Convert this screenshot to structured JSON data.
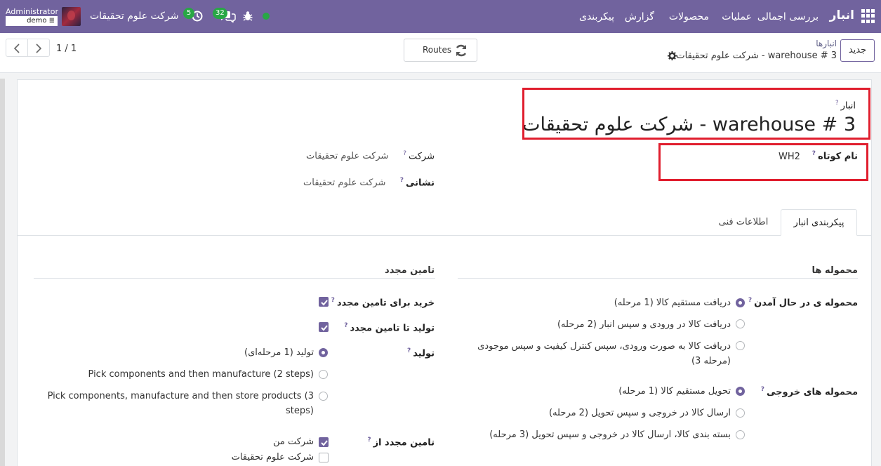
{
  "nav": {
    "brand": "انبار",
    "menu": [
      "بررسی اجمالی",
      "عملیات",
      "محصولات",
      "گزارش",
      "پیکربندی"
    ],
    "chat_count": "32",
    "activity_count": "5",
    "company": "شرکت علوم تحقیقات",
    "user_name": "Administrator",
    "user_db": "demo"
  },
  "control": {
    "new_label": "جدید",
    "breadcrumb_parent": "انبارها",
    "breadcrumb_current": "شرکت علوم تحقیقات - warehouse # 3",
    "routes_label": "Routes",
    "pager": "1 / 1"
  },
  "form": {
    "warehouse_label": "انبار",
    "warehouse_name": "شرکت علوم تحقیقات - warehouse # 3",
    "short_name_label": "نام کوتاه",
    "short_name": "WH2",
    "company_label": "شرکت",
    "company_value": "شرکت علوم تحقیقات",
    "address_label": "نشانی",
    "address_value": "شرکت علوم تحقیقات"
  },
  "tabs": [
    "پیکربندی انبار",
    "اطلاعات فنی"
  ],
  "shipments": {
    "title": "محموله ها",
    "incoming_label": "محموله ی در حال آمدن",
    "incoming_options": [
      "دریافت مستقیم کالا (1 مرحله)",
      "دریافت کالا در ورودی و سپس انبار (2 مرحله)",
      "دریافت کالا به صورت ورودی، سپس کنترل کیفیت و سپس موجودی",
      "(3 مرحله)"
    ],
    "outgoing_label": "محموله های خروجی",
    "outgoing_options": [
      "تحویل مستقیم کالا (1 مرحله)",
      "ارسال کالا در خروجی و سپس تحویل (2 مرحله)",
      "بسته بندی کالا، ارسال کالا در خروجی و سپس تحویل (3 مرحله)"
    ]
  },
  "resupply": {
    "title": "تامین مجدد",
    "buy_label": "خرید برای تامین مجدد",
    "mto_label": "تولید تا تامین مجدد",
    "manufacture_label": "تولید",
    "manufacture_options": [
      "تولید (1 مرحله‌ای)",
      "Pick components and then manufacture (2 steps)",
      "Pick components, manufacture and then store products (3",
      "steps)"
    ],
    "resupply_from_label": "تامین مجدد از",
    "resupply_from_options": [
      "شرکت من",
      "شرکت علوم تحقیقات"
    ]
  }
}
